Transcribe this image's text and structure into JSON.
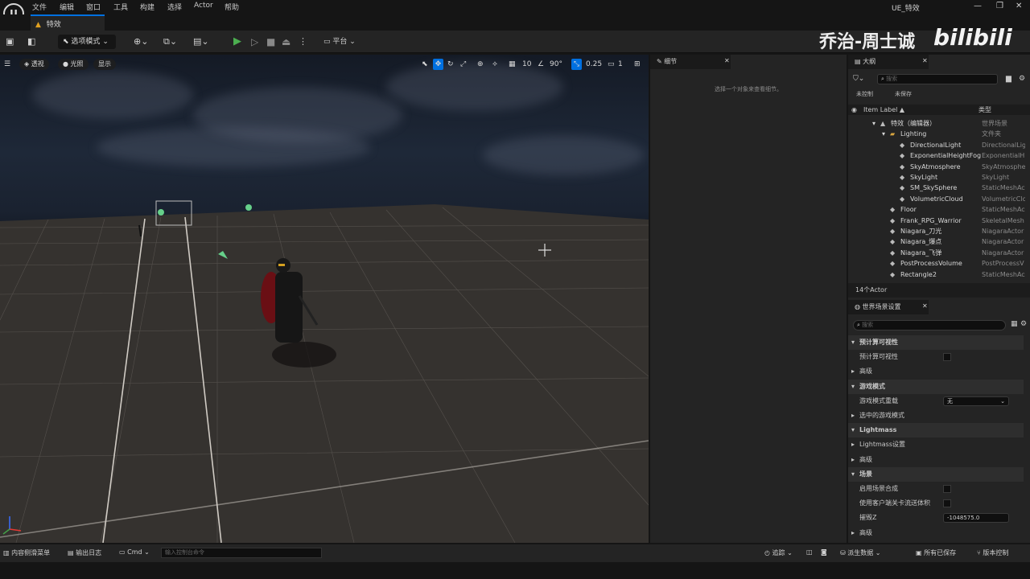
{
  "menu": {
    "items": [
      "文件",
      "编辑",
      "窗口",
      "工具",
      "构建",
      "选择",
      "Actor",
      "帮助"
    ],
    "logo": "U"
  },
  "window": {
    "title": "UE_特效",
    "minimize": "—",
    "maximize": "❐",
    "close": "✕"
  },
  "doc_tab": {
    "label": "特效"
  },
  "toolbar": {
    "mode_label": "选项模式",
    "platform_label": "平台"
  },
  "watermark": {
    "author": "乔治-周士诚",
    "brand": "bilibili"
  },
  "viewport": {
    "perspective": "透视",
    "lighting": "光照",
    "show": "显示",
    "grid_value": "10",
    "angle_value": "90°",
    "scale_value": "0.25",
    "camera_speed": "1"
  },
  "details": {
    "tab": "细节",
    "empty_message": "选择一个对象来查看细节。"
  },
  "outliner": {
    "tab": "大纲",
    "search_placeholder": "搜索",
    "filter_unsaved": "未控制",
    "filter_saved": "未保存",
    "col_label": "Item Label ▲",
    "col_type": "类型",
    "rows": [
      {
        "label": "特效（编辑器）",
        "type": "世界场景",
        "indent": 0
      },
      {
        "label": "Lighting",
        "type": "文件夹",
        "indent": 1
      },
      {
        "label": "DirectionalLight",
        "type": "DirectionalLig",
        "indent": 2
      },
      {
        "label": "ExponentialHeightFog",
        "type": "ExponentialH",
        "indent": 2
      },
      {
        "label": "SkyAtmosphere",
        "type": "SkyAtmosphe",
        "indent": 2
      },
      {
        "label": "SkyLight",
        "type": "SkyLight",
        "indent": 2
      },
      {
        "label": "SM_SkySphere",
        "type": "StaticMeshAc",
        "indent": 2
      },
      {
        "label": "VolumetricCloud",
        "type": "VolumetricClo",
        "indent": 2
      },
      {
        "label": "Floor",
        "type": "StaticMeshAc",
        "indent": 1
      },
      {
        "label": "Frank_RPG_Warrior",
        "type": "SkeletalMesh",
        "indent": 1
      },
      {
        "label": "Niagara_刀光",
        "type": "NiagaraActor",
        "indent": 1
      },
      {
        "label": "Niagara_爆点",
        "type": "NiagaraActor",
        "indent": 1
      },
      {
        "label": "Niagara_飞弹",
        "type": "NiagaraActor",
        "indent": 1
      },
      {
        "label": "PostProcessVolume",
        "type": "PostProcessV",
        "indent": 1
      },
      {
        "label": "Rectangle2",
        "type": "StaticMeshAc",
        "indent": 1
      }
    ],
    "actor_count": "14个Actor"
  },
  "world_settings": {
    "tab": "世界场景设置",
    "search_placeholder": "搜索",
    "rows": [
      {
        "label": "预计算可视性",
        "kind": "section"
      },
      {
        "label": "预计算可视性",
        "kind": "check"
      },
      {
        "label": "高级",
        "kind": "expand"
      },
      {
        "label": "游戏模式",
        "kind": "section"
      },
      {
        "label": "游戏模式重载",
        "kind": "dropdown",
        "value": "无"
      },
      {
        "label": "选中的游戏模式",
        "kind": "expand"
      },
      {
        "label": "Lightmass",
        "kind": "section"
      },
      {
        "label": "Lightmass设置",
        "kind": "expand"
      },
      {
        "label": "高级",
        "kind": "expand"
      },
      {
        "label": "场景",
        "kind": "section"
      },
      {
        "label": "启用场景合成",
        "kind": "check"
      },
      {
        "label": "使用客户端关卡流送体积",
        "kind": "check"
      },
      {
        "label": "摧毁Z",
        "kind": "value",
        "value": "-1048575.0"
      },
      {
        "label": "高级",
        "kind": "expand"
      }
    ]
  },
  "statusbar": {
    "content_drawer": "内容侧滑菜单",
    "output_log": "输出日志",
    "cmd": "Cmd",
    "cmd_placeholder": "输入控制台命令",
    "trace": "追踪",
    "derived_data": "派生数据",
    "all_saved": "所有已保存",
    "source_control": "版本控制"
  },
  "colors": {
    "accent": "#0070e0",
    "play": "#4caf50",
    "panel": "#242424",
    "background": "#151515"
  }
}
